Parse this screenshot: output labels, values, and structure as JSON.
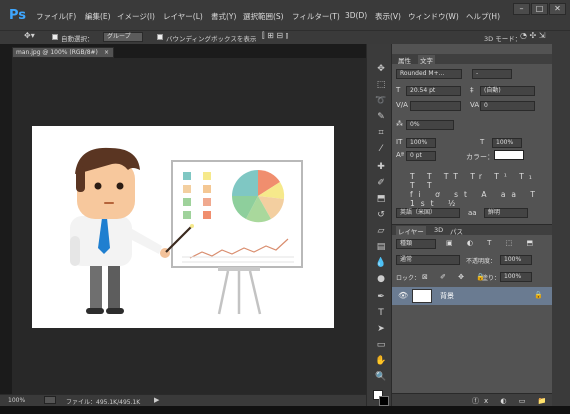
{
  "app": {
    "logo": "Ps"
  },
  "menu": [
    "ファイル(F)",
    "編集(E)",
    "イメージ(I)",
    "レイヤー(L)",
    "書式(Y)",
    "選択範囲(S)",
    "フィルター(T)",
    "3D(D)",
    "表示(V)",
    "ウィンドウ(W)",
    "ヘルプ(H)"
  ],
  "window_buttons": [
    "–",
    "□",
    "✕"
  ],
  "options": {
    "auto_select_label": "自動選択：",
    "auto_select_value": "グループ",
    "bbox_label": "バウンディングボックスを表示",
    "mode_3d": "3D モード："
  },
  "doc_tab": {
    "label": "man.jpg @ 100% (RGB/8#)",
    "close": "×"
  },
  "status": {
    "zoom": "100%",
    "file_info": "ファイル：495.1K/495.1K"
  },
  "char_panel": {
    "tabs": [
      "属性",
      "文字"
    ],
    "font_family": "Rounded M+...",
    "font_style": "-",
    "font_size": "20.54 pt",
    "leading": "(自動)",
    "kerning": "",
    "tracking": "0",
    "vscale": "0%",
    "hscale_v": "100%",
    "hscale_h": "100%",
    "baseline": "0 pt",
    "color_label": "カラー：",
    "color": "#ffffff",
    "language": "英語（米国）",
    "antialias": "鮮明"
  },
  "layers_panel": {
    "tabs": [
      "レイヤー",
      "3D",
      "パス"
    ],
    "filter": "種類",
    "blend_mode": "通常",
    "opacity_label": "不透明度：",
    "opacity": "100%",
    "lock_label": "ロック：",
    "fill_label": "塗り：",
    "fill": "100%",
    "layer_name": "背景"
  },
  "colors": {
    "accent": "#3fa7ff",
    "shirt": "#f3f3f3",
    "tie": "#1f7fd0",
    "hair": "#5a3522"
  }
}
